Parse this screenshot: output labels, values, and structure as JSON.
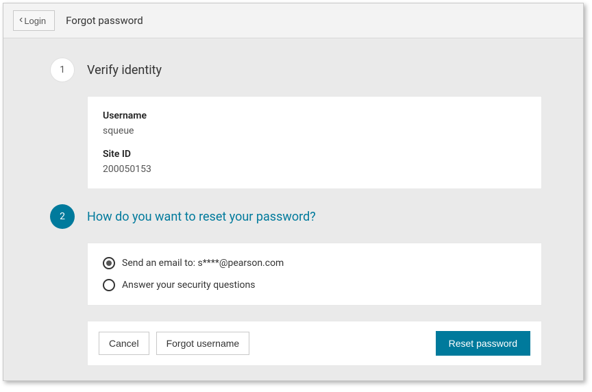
{
  "header": {
    "login_button": "Login",
    "title": "Forgot password"
  },
  "step1": {
    "number": "1",
    "title": "Verify identity",
    "username_label": "Username",
    "username_value": "squeue",
    "siteid_label": "Site ID",
    "siteid_value": "200050153"
  },
  "step2": {
    "number": "2",
    "title": "How do you want to reset your password?",
    "options": {
      "email": "Send an email to: s****@pearson.com",
      "security": "Answer your security questions"
    }
  },
  "buttons": {
    "cancel": "Cancel",
    "forgot_username": "Forgot username",
    "reset_password": "Reset password"
  }
}
